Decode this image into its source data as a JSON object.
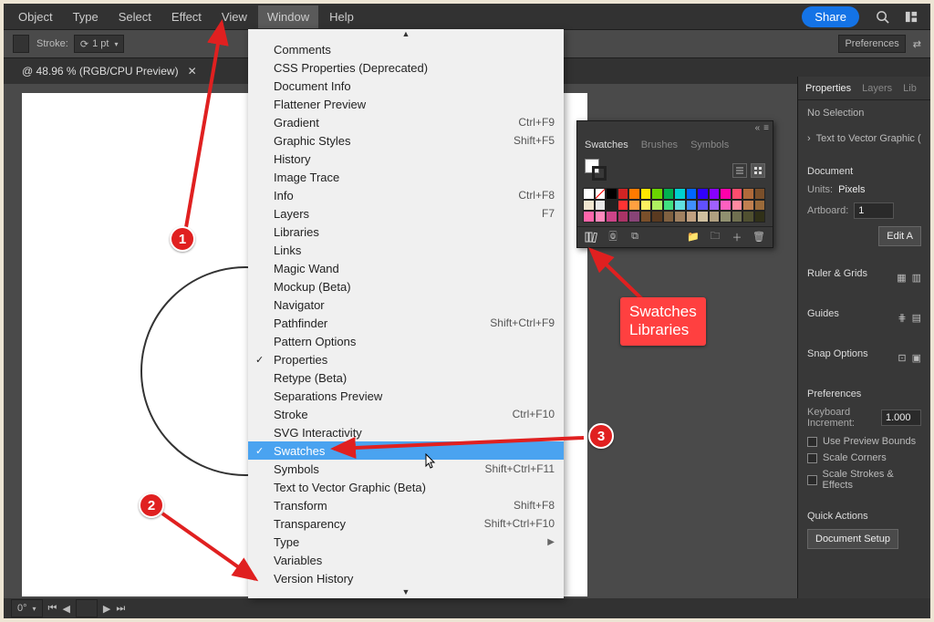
{
  "menubar": {
    "items": [
      "Object",
      "Type",
      "Select",
      "Effect",
      "View",
      "Window",
      "Help"
    ],
    "share": "Share"
  },
  "optbar": {
    "stroke_label": "Stroke:",
    "stroke_value": "1 pt",
    "prefs": "Preferences"
  },
  "doctab": {
    "title": "@ 48.96 % (RGB/CPU Preview)"
  },
  "statusbar": {
    "zoom": "0°"
  },
  "dropdown": {
    "items": [
      {
        "label": "Comments"
      },
      {
        "label": "CSS Properties (Deprecated)"
      },
      {
        "label": "Document Info"
      },
      {
        "label": "Flattener Preview"
      },
      {
        "label": "Gradient",
        "shortcut": "Ctrl+F9"
      },
      {
        "label": "Graphic Styles",
        "shortcut": "Shift+F5"
      },
      {
        "label": "History"
      },
      {
        "label": "Image Trace"
      },
      {
        "label": "Info",
        "shortcut": "Ctrl+F8"
      },
      {
        "label": "Layers",
        "shortcut": "F7"
      },
      {
        "label": "Libraries"
      },
      {
        "label": "Links"
      },
      {
        "label": "Magic Wand"
      },
      {
        "label": "Mockup (Beta)"
      },
      {
        "label": "Navigator"
      },
      {
        "label": "Pathfinder",
        "shortcut": "Shift+Ctrl+F9"
      },
      {
        "label": "Pattern Options"
      },
      {
        "label": "Properties",
        "checked": true
      },
      {
        "label": "Retype (Beta)"
      },
      {
        "label": "Separations Preview"
      },
      {
        "label": "Stroke",
        "shortcut": "Ctrl+F10"
      },
      {
        "label": "SVG Interactivity"
      },
      {
        "label": "Swatches",
        "checked": true,
        "selected": true
      },
      {
        "label": "Symbols",
        "shortcut": "Shift+Ctrl+F11"
      },
      {
        "label": "Text to Vector Graphic (Beta)"
      },
      {
        "label": "Transform",
        "shortcut": "Shift+F8"
      },
      {
        "label": "Transparency",
        "shortcut": "Shift+Ctrl+F10"
      },
      {
        "label": "Type",
        "submenu": true
      },
      {
        "label": "Variables"
      },
      {
        "label": "Version History"
      }
    ]
  },
  "swatches": {
    "tabs": [
      "Swatches",
      "Brushes",
      "Symbols"
    ],
    "rows": [
      [
        "#ffffff",
        "#ffffff",
        "#000000",
        "#d02424",
        "#ff7a00",
        "#ffe600",
        "#6ad400",
        "#00b050",
        "#00d0d0",
        "#0066ff",
        "#3000ff",
        "#8800ff",
        "#ff00aa",
        "#ff4d6d",
        "#b06a3a",
        "#7a4f2a"
      ],
      [
        "#f0e6d0",
        "#e8e8e8",
        "#222222",
        "#ff3333",
        "#ffa040",
        "#fff060",
        "#aef060",
        "#40e080",
        "#60e0e0",
        "#4090ff",
        "#6050ff",
        "#a060ff",
        "#ff60c0",
        "#ff8aa0",
        "#c08050",
        "#9a6a3a"
      ],
      [
        "#ff66aa",
        "#ff88bb",
        "#cc4488",
        "#aa3366",
        "#884477",
        "#7a4f2a",
        "#5a3a20",
        "#806040",
        "#a08060",
        "#c0a080",
        "#d0c0a0",
        "#b0a080",
        "#909070",
        "#707050",
        "#505030",
        "#303018"
      ]
    ]
  },
  "props": {
    "tabs": [
      "Properties",
      "Layers",
      "Lib"
    ],
    "noSel": "No Selection",
    "t2v": "Text to Vector Graphic (",
    "doc": "Document",
    "units_label": "Units:",
    "units_value": "Pixels",
    "artboard_label": "Artboard:",
    "artboard_value": "1",
    "editA": "Edit A",
    "ruler": "Ruler & Grids",
    "guides": "Guides",
    "snap": "Snap Options",
    "prefs": "Preferences",
    "kb_label": "Keyboard Increment:",
    "kb_value": "1.000",
    "cb1": "Use Preview Bounds",
    "cb2": "Scale Corners",
    "cb3": "Scale Strokes & Effects",
    "quick": "Quick Actions",
    "docsetup": "Document Setup"
  },
  "annot": {
    "b1": "1",
    "b2": "2",
    "b3": "3",
    "callout": "Swatches\nLibraries"
  }
}
